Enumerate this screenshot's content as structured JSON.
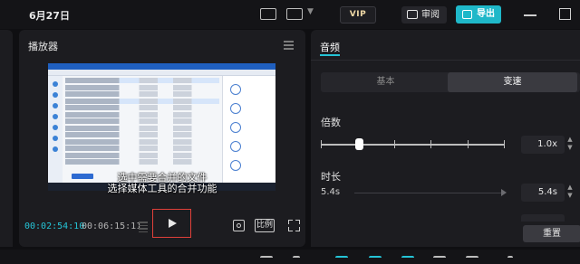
{
  "topbar": {
    "date": "6月27日",
    "vip_label": "VIP",
    "review_label": "审阅",
    "export_label": "导出",
    "accent_color": "#1fb8c9"
  },
  "player": {
    "title": "播放器",
    "subtitle_line1": "选中需要合并的文件",
    "subtitle_line2": "选择媒体工具的合并功能",
    "current_time": "00:02:54:10",
    "total_time": "00:06:15:11",
    "ratio_label": "比例",
    "icons": [
      "menu-icon",
      "bars-icon",
      "play-icon",
      "scan-icon",
      "fullscreen-icon"
    ]
  },
  "right_panel": {
    "tab": "音频",
    "segments": [
      {
        "label": "基本",
        "active": false
      },
      {
        "label": "变速",
        "active": true
      }
    ],
    "speed": {
      "label": "倍数",
      "value": "1.0x"
    },
    "duration": {
      "label": "时长",
      "from": "5.4s",
      "to": "5.4s"
    },
    "reset_label": "重置"
  }
}
